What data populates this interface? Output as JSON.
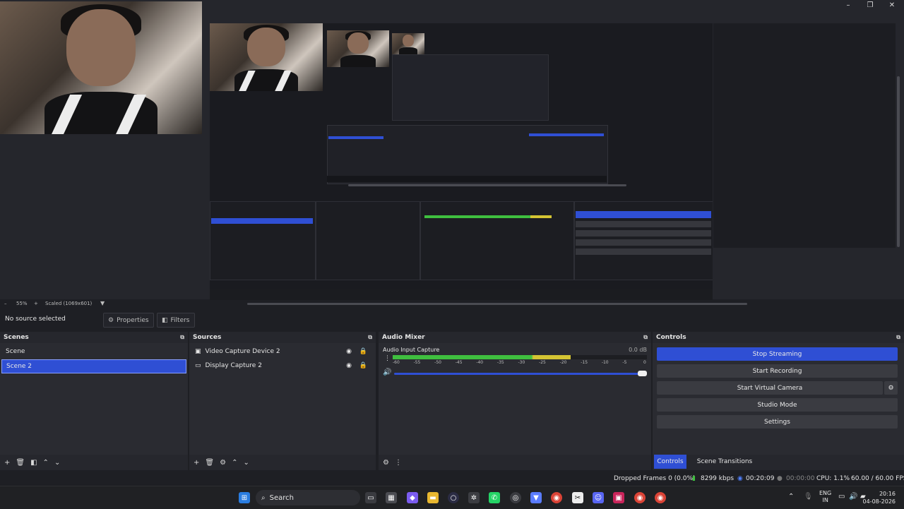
{
  "window": {
    "minimize": "–",
    "maximize": "❐",
    "close": "✕"
  },
  "preview": {
    "zoom": "55%",
    "scaled": "Scaled (1069x601)"
  },
  "no_source": "No source selected",
  "properties_label": "Properties",
  "filters_label": "Filters",
  "scenes": {
    "title": "Scenes",
    "items": [
      {
        "label": "Scene"
      },
      {
        "label": "Scene 2"
      }
    ]
  },
  "sources": {
    "title": "Sources",
    "items": [
      {
        "label": "Video Capture Device 2",
        "icon": "camera-icon"
      },
      {
        "label": "Display Capture 2",
        "icon": "monitor-icon"
      }
    ]
  },
  "mixer": {
    "title": "Audio Mixer",
    "channel": "Audio Input Capture",
    "db": "0.0 dB",
    "ticks": [
      "-60",
      "-55",
      "-50",
      "-45",
      "-40",
      "-35",
      "-30",
      "-25",
      "-20",
      "-15",
      "-10",
      "-5",
      "0"
    ],
    "level": 0.7
  },
  "controls": {
    "title": "Controls",
    "buttons": [
      "Stop Streaming",
      "Start Recording",
      "Start Virtual Camera",
      "Studio Mode",
      "Settings"
    ],
    "tabs": [
      "Controls",
      "Scene Transitions"
    ]
  },
  "status": {
    "dropped": "Dropped Frames 0 (0.0%)",
    "kbps": "8299 kbps",
    "stream_time": "00:20:09",
    "rec_time": "00:00:00",
    "cpu": "CPU: 1.1%",
    "fps": "60.00 / 60.00 FPS"
  },
  "taskbar": {
    "search": "Search",
    "lang1": "ENG",
    "lang2": "IN",
    "time": "20:16",
    "date": "04-08-2026"
  },
  "colors": {
    "accent": "#2f4fd4",
    "meter_green": "#3fbf3f",
    "meter_yellow": "#d4c433",
    "meter_red": "#cc3333"
  }
}
